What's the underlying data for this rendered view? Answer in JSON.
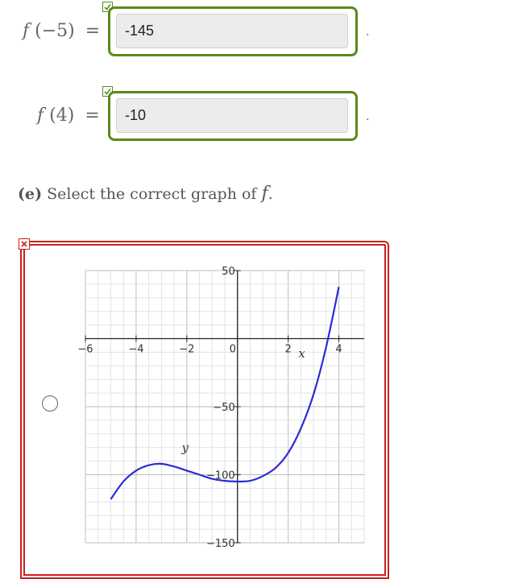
{
  "rows": [
    {
      "fn": "f",
      "arg": "(−5)",
      "eq": "=",
      "value": "-145"
    },
    {
      "fn": "f",
      "arg": "(4)",
      "eq": "=",
      "value": "-10"
    }
  ],
  "period": ".",
  "question": {
    "part": "(e)",
    "text": "Select the correct graph of",
    "fn": "f",
    "end": "."
  },
  "colors": {
    "correct": "#5a8a1a",
    "incorrect": "#cc1f1f",
    "curve": "#2b2bd6"
  },
  "chart_data": {
    "type": "line",
    "xlabel": "x",
    "ylabel": "y",
    "xlim": [
      -6,
      5
    ],
    "ylim": [
      -150,
      50
    ],
    "x_ticks": [
      "-6",
      "-4",
      "-2",
      "0",
      "2",
      "4"
    ],
    "y_ticks": [
      "50",
      "-50",
      "-100",
      "-150"
    ],
    "grid": true,
    "series": [
      {
        "x": [
          -5,
          -4.5,
          -4,
          -3.5,
          -3,
          -2.5,
          -2,
          -1.5,
          -1,
          -0.5,
          0,
          0.5,
          1,
          1.5,
          2,
          2.5,
          3,
          3.5,
          4
        ],
        "y": [
          -118,
          -105,
          -97,
          -93,
          -92,
          -94,
          -97,
          -100,
          -103,
          -104.5,
          -105,
          -104.5,
          -101,
          -95,
          -84,
          -66,
          -41,
          -6,
          38
        ]
      }
    ]
  }
}
